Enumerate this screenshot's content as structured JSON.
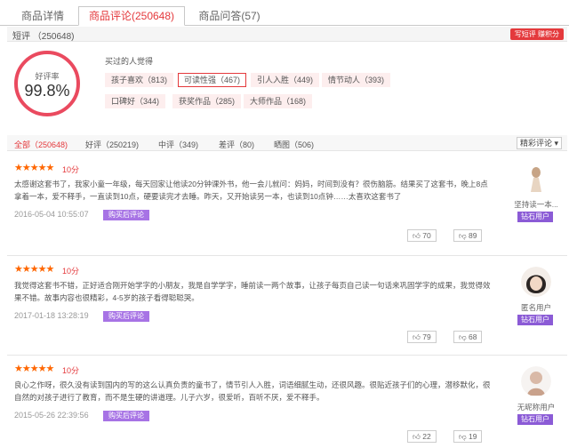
{
  "tabs": [
    {
      "label": "商品详情",
      "active": false
    },
    {
      "label": "商品评论(250648)",
      "active": true
    },
    {
      "label": "商品问答(57)",
      "active": false
    }
  ],
  "short_review": {
    "label": "短评 （250648)",
    "write_button": "写短评 赚积分"
  },
  "rating": {
    "label": "好评率",
    "value": "99.8%"
  },
  "impressions": {
    "title": "买过的人觉得",
    "tags": [
      "孩子喜欢（813)",
      "可读性强（467)",
      "引人入胜（449)",
      "情节动人（393)",
      "口碑好（344)",
      "获奖作品（285)",
      "大师作品（168)"
    ]
  },
  "filters": {
    "items": [
      "全部（250648)",
      "好评（250219)",
      "中评（349)",
      "差评（80)",
      "晒图（506)"
    ],
    "sort_label": "精彩评论"
  },
  "reviews": [
    {
      "stars": "★★★★★",
      "score": "10分",
      "text": "太感谢这套书了，我家小童一年级，每天回家让他读20分钟课外书，他一会儿就问：妈妈，时间到没有？很伤脑筋。结果买了这套书，晚上8点拿着一本，爱不释手，一直读到10点，硬要读完才去睡。昨天，又开始读另一本，也读到10点钟……太喜欢这套书了",
      "date": "2016-05-04 10:55:07",
      "buy_tag": "购买后评论",
      "likes": "70",
      "dislikes": "89",
      "user": "坚持读一本...",
      "level": "钻石用户"
    },
    {
      "stars": "★★★★★",
      "score": "10分",
      "text": "我觉得这套书不错，正好适合刚开始学字的小朋友，我是自学学字，睡前读一两个故事，让孩子每页自己读一句话来巩固学字的成果，我觉得效果不错。故事内容也很精彩，4-5岁的孩子看得聪聪哭。",
      "date": "2017-01-18 13:28:19",
      "buy_tag": "购买后评论",
      "likes": "79",
      "dislikes": "68",
      "user": "匿名用户",
      "level": "钻石用户"
    },
    {
      "stars": "★★★★★",
      "score": "10分",
      "text": "良心之作呀，很久没有读到国内的写的这么认真负责的童书了，情节引人入胜，词语细腻生动，还很风趣。很贴近孩子们的心理，潜移默化，很自然的对孩子进行了教育，而不是生硬的讲道理。儿子六岁，很爱听，百听不厌，爱不释手。",
      "date": "2015-05-26 22:39:56",
      "buy_tag": "购买后评论",
      "likes": "22",
      "dislikes": "19",
      "user": "无昵称用户",
      "level": "钻石用户"
    }
  ],
  "colors": {
    "accent": "#e4393c",
    "star": "#ff6600",
    "buy_tag": "#a773e5",
    "level_tag": "#8b5bd6",
    "ring": "#ea4a5f"
  }
}
